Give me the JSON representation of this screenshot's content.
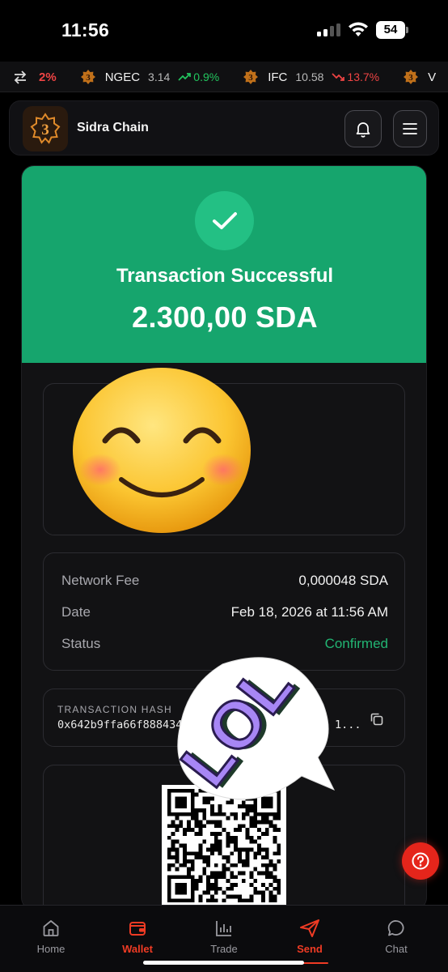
{
  "status_bar": {
    "time": "11:56",
    "battery": "54"
  },
  "ticker": {
    "lead_change": "2%",
    "items": [
      {
        "symbol": "NGEC",
        "price": "3.14",
        "change": "0.9%",
        "direction": "up"
      },
      {
        "symbol": "IFC",
        "price": "10.58",
        "change": "13.7%",
        "direction": "down"
      }
    ],
    "trailing_symbol": "V"
  },
  "header": {
    "app_name": "Sidra Chain",
    "bell_icon": "bell-icon",
    "menu_icon": "menu-icon"
  },
  "transaction": {
    "title": "Transaction Successful",
    "amount": "2.300,00 SDA",
    "details": [
      {
        "label": "Network Fee",
        "value": "0,000048 SDA"
      },
      {
        "label": "Date",
        "value": "Feb 18, 2026 at 11:56 AM"
      },
      {
        "label": "Status",
        "value": "Confirmed"
      }
    ],
    "hash_label": "TRANSACTION HASH",
    "hash_visible_start": "0x642b9ffa66f8884349",
    "hash_visible_end": "1..."
  },
  "nav": {
    "items": [
      {
        "label": "Home",
        "icon": "home-icon"
      },
      {
        "label": "Wallet",
        "icon": "wallet-icon"
      },
      {
        "label": "Trade",
        "icon": "chart-icon"
      },
      {
        "label": "Send",
        "icon": "send-icon"
      },
      {
        "label": "Chat",
        "icon": "chat-icon"
      }
    ]
  },
  "colors": {
    "success": "#16a56d",
    "accent": "#ef3b24",
    "positive": "#22c55e",
    "negative": "#ef4444"
  }
}
